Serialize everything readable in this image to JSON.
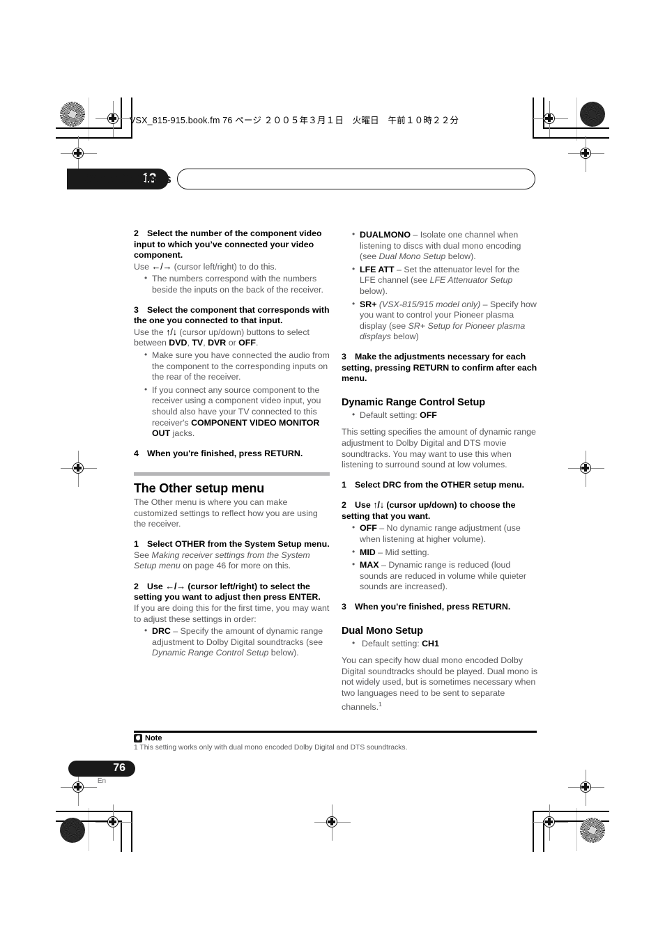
{
  "print_header": {
    "filename_line": "VSX_815-915.book.fm  76 ページ  ２００５年３月１日　火曜日　午前１０時２２分"
  },
  "chapter": {
    "number": "13",
    "title": "Other Settings"
  },
  "left_column": {
    "step2": {
      "num": "2",
      "heading": "Select the number of the component video input to which you’ve connected your video component.",
      "body_pre": "Use ",
      "arrows": "←/→",
      "body_post": " (cursor left/right) to do this.",
      "bullets": [
        "The numbers correspond with the numbers beside the inputs on the back of the receiver."
      ]
    },
    "step3": {
      "num": "3",
      "heading": "Select the component that corresponds with the one you connected to that input.",
      "body_pre": "Use the ",
      "arrows": "↑/↓",
      "body_mid": " (cursor up/down) buttons to select between ",
      "opt1": "DVD",
      "opt2": "TV",
      "opt3": "DVR",
      "opt4": "OFF",
      "body_post": ".",
      "bullet1": "Make sure you have connected the audio from the component to the corresponding inputs on the rear of the receiver.",
      "bullet2_pre": "If you connect any source component to the receiver using a component video input, you should also have your TV connected to this receiver's ",
      "bullet2_bold": "COMPONENT VIDEO MONITOR OUT",
      "bullet2_post": " jacks."
    },
    "step4": {
      "num": "4",
      "heading": "When you're finished, press RETURN."
    },
    "section": {
      "title": "The Other setup menu",
      "intro": "The Other menu is where you can make customized settings to reflect how you are using the receiver."
    },
    "step_o1": {
      "num": "1",
      "heading": "Select OTHER from the System Setup menu.",
      "body_pre": "See ",
      "body_italic": "Making receiver settings from the System Setup menu",
      "body_post": " on page 46 for more on this."
    },
    "step_o2": {
      "num": "2",
      "heading_pre": "Use ",
      "heading_arrows": "←/→",
      "heading_post": " (cursor left/right) to select the setting you want to adjust then press ENTER.",
      "body": "If you are doing this for the first time, you may want to adjust these settings in order:",
      "bullet_drc_bold": "DRC",
      "bullet_drc_pre": " – Specify the amount of dynamic range adjustment to Dolby Digital soundtracks (see ",
      "bullet_drc_italic": "Dynamic Range Control Setup",
      "bullet_drc_post": " below)."
    }
  },
  "right_column": {
    "bullets": [
      {
        "bold": "DUALMONO",
        "pre": " – Isolate one channel when listening to discs with dual mono encoding (see ",
        "italic": "Dual Mono Setup",
        "post": " below)."
      },
      {
        "bold": "LFE ATT",
        "pre": " – Set the attenuator level for the LFE channel (see ",
        "italic": "LFE Attenuator Setup",
        "post": " below)."
      },
      {
        "bold": "SR+",
        "italic_model": " (VSX-815/915 model only)",
        "pre": " – Specify how you want to control your Pioneer plasma display (see ",
        "italic": "SR+ Setup for Pioneer plasma displays",
        "post": " below)"
      }
    ],
    "step3": {
      "num": "3",
      "heading": "Make the adjustments necessary for each setting, pressing RETURN to confirm after each menu."
    },
    "drc_section": {
      "title": "Dynamic Range Control Setup",
      "default_label": "Default setting: ",
      "default_value": "OFF",
      "body": "This setting specifies the amount of dynamic range adjustment to Dolby Digital and DTS movie soundtracks. You may want to use this when listening to surround sound at low volumes."
    },
    "drc_step1": {
      "num": "1",
      "heading": "Select DRC from the OTHER setup menu."
    },
    "drc_step2": {
      "num": "2",
      "heading_pre": "Use ",
      "heading_arrows": "↑/↓",
      "heading_post": " (cursor up/down) to choose the setting that you want.",
      "options": [
        {
          "bold": "OFF",
          "text": " – No dynamic range adjustment (use when listening at higher volume)."
        },
        {
          "bold": "MID",
          "text": " – Mid setting."
        },
        {
          "bold": "MAX",
          "text": " – Dynamic range is reduced (loud sounds are reduced in volume while quieter sounds are increased)."
        }
      ]
    },
    "drc_step3": {
      "num": "3",
      "heading": "When you're finished, press RETURN."
    },
    "dualmono_section": {
      "title": "Dual Mono Setup",
      "default_label": "Default setting: ",
      "default_value": "CH1",
      "body": "You can specify how dual mono encoded Dolby Digital soundtracks should be played. Dual mono is not widely used, but is sometimes necessary when two languages need to be sent to separate channels.",
      "footnote_marker": "1"
    }
  },
  "note": {
    "label": "Note",
    "text": "1 This setting works only with dual mono encoded Dolby Digital and DTS soundtracks."
  },
  "footer": {
    "page_number": "76",
    "language": "En"
  }
}
